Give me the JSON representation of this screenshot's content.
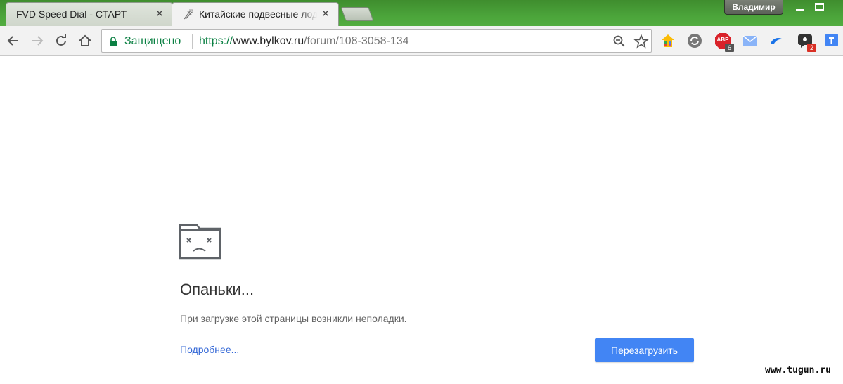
{
  "tabs": [
    {
      "title": "FVD Speed Dial - СТАРТ",
      "close_glyph": "✕",
      "active": false
    },
    {
      "title": "Китайские подвесные лодочные моторы",
      "close_glyph": "✕",
      "active": true
    }
  ],
  "window": {
    "profile_name": "Владимир"
  },
  "omnibox": {
    "security_label": "Защищено",
    "url_scheme": "https://",
    "url_host": "www.bylkov.ru",
    "url_path": "/forum/108-3058-134"
  },
  "extensions": {
    "adblock_label": "ABP",
    "adblock_badge": "6",
    "notes_badge": "2"
  },
  "error_page": {
    "heading": "Опаньки...",
    "message": "При загрузке этой страницы возникли неполадки.",
    "details_link": "Подробнее...",
    "reload_button": "Перезагрузить"
  },
  "watermark": "www.tugun.ru",
  "colors": {
    "tabstrip": "#4ba43a",
    "secure_green": "#0b8043",
    "link_blue": "#3367d6",
    "button_blue": "#4285f4"
  }
}
